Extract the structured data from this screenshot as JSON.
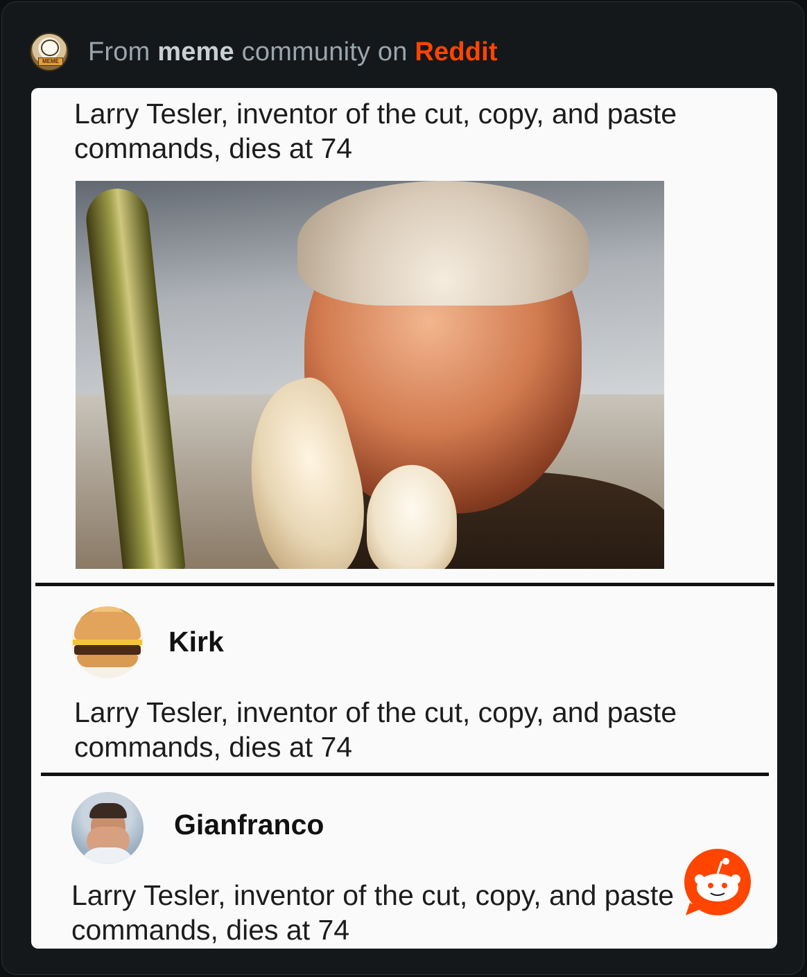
{
  "header": {
    "prefix": "From",
    "community": "meme",
    "middle": "community on",
    "platform": "Reddit",
    "avatar_label": "MEME"
  },
  "post": {
    "title": "Larry Tesler, inventor of the cut, copy, and paste commands, dies at 74"
  },
  "comments": [
    {
      "username": "Kirk",
      "text": "Larry Tesler, inventor of the cut, copy, and paste commands, dies at 74",
      "avatar": "burger-avatar"
    },
    {
      "username": "Gianfranco",
      "text": "Larry Tesler, inventor of the cut, copy, and paste commands, dies at 74",
      "avatar": "facepalm-avatar"
    }
  ],
  "colors": {
    "reddit_orange": "#ff4500",
    "background": "#0d1012",
    "card": "#fafafa"
  }
}
